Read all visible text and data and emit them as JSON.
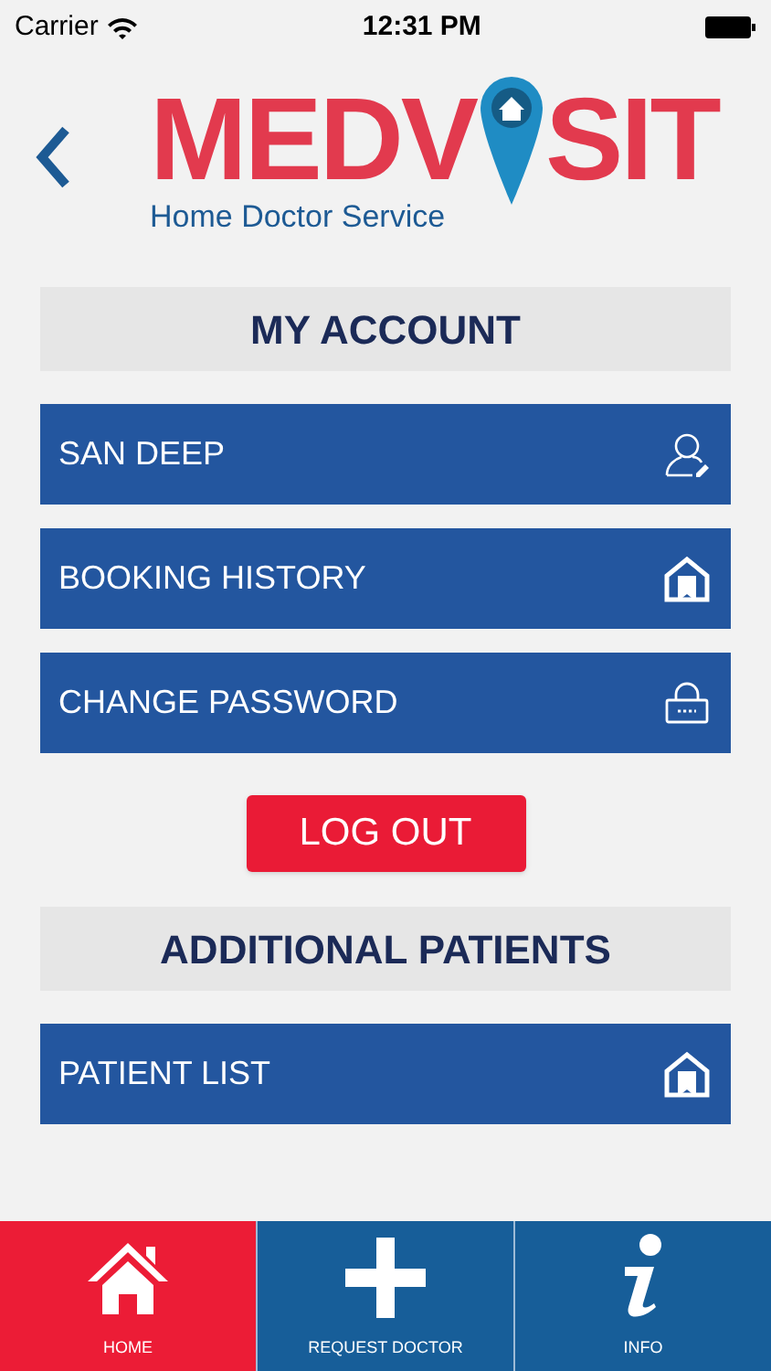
{
  "status_bar": {
    "carrier": "Carrier",
    "time": "12:31 PM"
  },
  "logo": {
    "left": "MEDV",
    "right": "SIT",
    "tagline": "Home Doctor Service"
  },
  "account_section": {
    "title": "MY ACCOUNT",
    "items": [
      {
        "label": "SAN DEEP",
        "kind": "profile"
      },
      {
        "label": "BOOKING HISTORY",
        "kind": "history"
      },
      {
        "label": "CHANGE PASSWORD",
        "kind": "password"
      }
    ]
  },
  "logout_button": "LOG OUT",
  "patients_section": {
    "title": "ADDITIONAL PATIENTS",
    "items": [
      {
        "label": "PATIENT LIST",
        "kind": "history"
      }
    ]
  },
  "tab_bar": [
    {
      "label": "HOME",
      "kind": "home",
      "selected": true
    },
    {
      "label": "REQUEST DOCTOR",
      "kind": "plus",
      "selected": false
    },
    {
      "label": "INFO",
      "kind": "info",
      "selected": false
    }
  ]
}
